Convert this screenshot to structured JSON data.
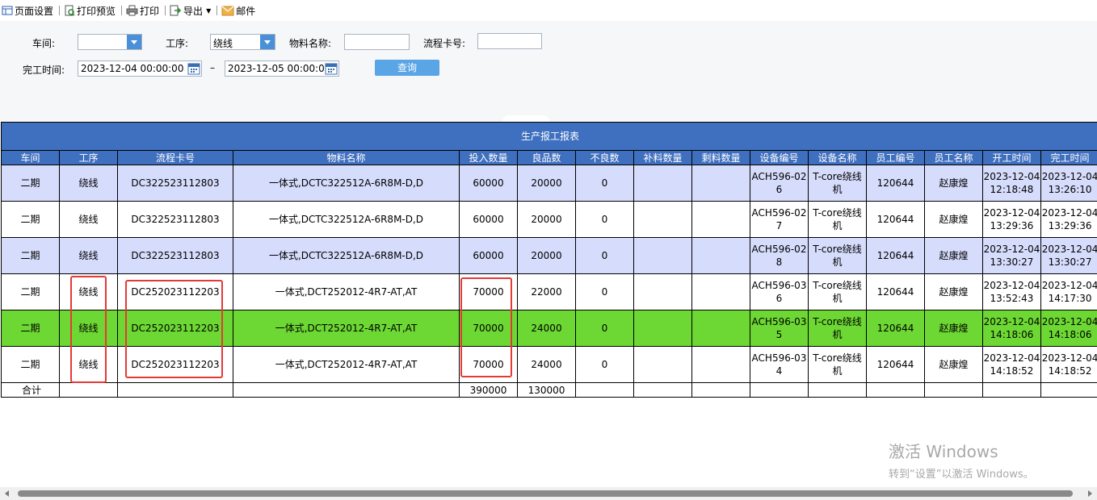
{
  "toolbar": {
    "page_setup": "页面设置",
    "print_preview": "打印预览",
    "print": "打印",
    "export": "导出",
    "mail": "邮件"
  },
  "filter": {
    "workshop_label": "车间:",
    "workshop_value": "",
    "process_label": "工序:",
    "process_value": "绕线",
    "material_label": "物料名称:",
    "material_value": "",
    "card_label": "流程卡号:",
    "card_value": "",
    "time_label": "完工时间:",
    "time_from": "2023-12-04 00:00:00",
    "time_sep": "–",
    "time_to": "2023-12-05 00:00:00",
    "query_button": "查询"
  },
  "report": {
    "title": "生产报工报表",
    "columns": [
      "车间",
      "工序",
      "流程卡号",
      "物料名称",
      "投入数量",
      "良品数",
      "不良数",
      "补料数量",
      "剩料数量",
      "设备编号",
      "设备名称",
      "员工编号",
      "员工名称",
      "开工时间",
      "完工时间"
    ],
    "rows": [
      [
        "二期",
        "绕线",
        "DC322523112803",
        "一体式,DCTC322512A-6R8M-D,D",
        "60000",
        "20000",
        "0",
        "",
        "",
        "ACH596-026",
        "T-core绕线机",
        "120644",
        "赵康煌",
        "2023-12-04 12:18:48",
        "2023-12-04 13:26:10"
      ],
      [
        "二期",
        "绕线",
        "DC322523112803",
        "一体式,DCTC322512A-6R8M-D,D",
        "60000",
        "20000",
        "0",
        "",
        "",
        "ACH596-027",
        "T-core绕线机",
        "120644",
        "赵康煌",
        "2023-12-04 13:29:36",
        "2023-12-04 13:29:36"
      ],
      [
        "二期",
        "绕线",
        "DC322523112803",
        "一体式,DCTC322512A-6R8M-D,D",
        "60000",
        "20000",
        "0",
        "",
        "",
        "ACH596-028",
        "T-core绕线机",
        "120644",
        "赵康煌",
        "2023-12-04 13:30:27",
        "2023-12-04 13:30:27"
      ],
      [
        "二期",
        "绕线",
        "DC252023112203",
        "一体式,DCT252012-4R7-AT,AT",
        "70000",
        "22000",
        "0",
        "",
        "",
        "ACH596-036",
        "T-core绕线机",
        "120644",
        "赵康煌",
        "2023-12-04 13:52:43",
        "2023-12-04 14:17:30"
      ],
      [
        "二期",
        "绕线",
        "DC252023112203",
        "一体式,DCT252012-4R7-AT,AT",
        "70000",
        "24000",
        "0",
        "",
        "",
        "ACH596-035",
        "T-core绕线机",
        "120644",
        "赵康煌",
        "2023-12-04 14:18:06",
        "2023-12-04 14:18:06"
      ],
      [
        "二期",
        "绕线",
        "DC252023112203",
        "一体式,DCT252012-4R7-AT,AT",
        "70000",
        "24000",
        "0",
        "",
        "",
        "ACH596-034",
        "T-core绕线机",
        "120644",
        "赵康煌",
        "2023-12-04 14:18:52",
        "2023-12-04 14:18:52"
      ]
    ],
    "row_colors": [
      "#d6dcfb",
      "#ffffff",
      "#d6dcfb",
      "#ffffff",
      "#6dd733",
      "#ffffff"
    ],
    "total": [
      "合计",
      "",
      "",
      "",
      "390000",
      "130000",
      "",
      "",
      "",
      "",
      "",
      "",
      "",
      "",
      ""
    ]
  },
  "colors": {
    "header_blue": "#3f6fbf",
    "row_lavender": "#d6dcfb",
    "row_green": "#6dd733",
    "highlight_red": "#e53935",
    "query_button": "#5aa5e6"
  },
  "watermark": {
    "line1": "激活 Windows",
    "line2": "转到“设置”以激活 Windows。"
  }
}
